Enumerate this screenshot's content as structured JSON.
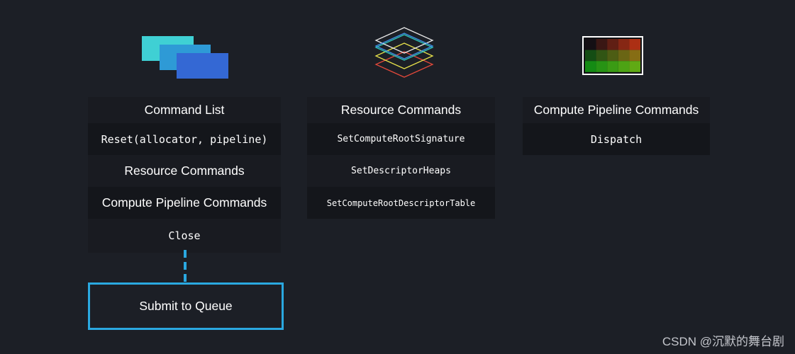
{
  "columns": [
    {
      "header": "Command List",
      "items": [
        "Reset(allocator, pipeline)",
        "Resource Commands",
        "Compute Pipeline Commands",
        "Close"
      ]
    },
    {
      "header": "Resource Commands",
      "items": [
        "SetComputeRootSignature",
        "SetDescriptorHeaps",
        "SetComputeRootDescriptorTable"
      ]
    },
    {
      "header": "Compute Pipeline Commands",
      "items": [
        "Dispatch"
      ]
    }
  ],
  "submit_label": "Submit to Queue",
  "watermark": "CSDN @沉默的舞台剧",
  "icons": [
    "stacked-command-lists-icon",
    "resource-layers-icon",
    "compute-grid-icon"
  ],
  "colors": {
    "background": "#1c1f26",
    "accent": "#2aa8e0",
    "stack": [
      "#3fd0d4",
      "#2e9ad6",
      "#3468d4"
    ],
    "layers": [
      "#e8e8e8",
      "#3f8fe8",
      "#2dc6b6",
      "#e6e04a",
      "#e2483a"
    ]
  }
}
